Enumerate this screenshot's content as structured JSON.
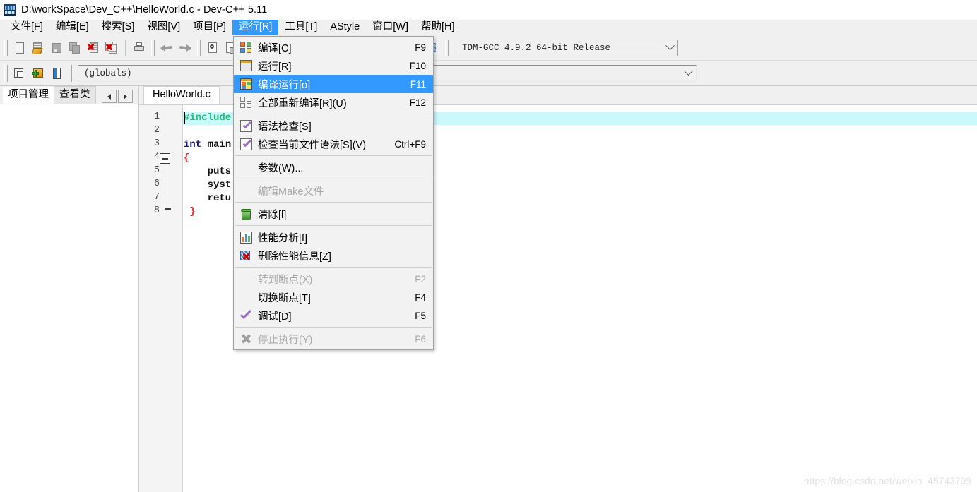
{
  "window": {
    "title": "D:\\workSpace\\Dev_C++\\HelloWorld.c - Dev-C++ 5.11",
    "icon": "devcpp-app-icon"
  },
  "menubar": {
    "items": [
      {
        "label": "文件[F]",
        "active": false
      },
      {
        "label": "编辑[E]",
        "active": false
      },
      {
        "label": "搜索[S]",
        "active": false
      },
      {
        "label": "视图[V]",
        "active": false
      },
      {
        "label": "项目[P]",
        "active": false
      },
      {
        "label": "运行[R]",
        "active": true
      },
      {
        "label": "工具[T]",
        "active": false
      },
      {
        "label": "AStyle",
        "active": false
      },
      {
        "label": "窗口[W]",
        "active": false
      },
      {
        "label": "帮助[H]",
        "active": false
      }
    ]
  },
  "toolbar": {
    "row1": [
      {
        "icon": "new-file-icon"
      },
      {
        "icon": "open-file-icon"
      },
      {
        "icon": "save-file-icon"
      },
      {
        "icon": "save-all-icon"
      },
      {
        "icon": "close-file-icon"
      },
      {
        "icon": "close-all-icon"
      },
      {
        "icon": "print-icon"
      },
      {
        "icon": "undo-icon"
      },
      {
        "icon": "redo-icon"
      },
      {
        "icon": "find-icon"
      },
      {
        "icon": "replace-icon"
      },
      {
        "icon": "goto-line-icon"
      },
      {
        "icon": "compile-icon"
      },
      {
        "icon": "run-icon"
      },
      {
        "icon": "compile-run-icon"
      },
      {
        "icon": "rebuild-all-icon"
      },
      {
        "icon": "debug-check-icon"
      },
      {
        "icon": "stop-execution-icon"
      },
      {
        "icon": "profile-analysis-icon"
      },
      {
        "icon": "delete-profile-icon"
      }
    ],
    "compiler_combo": {
      "value": "TDM-GCC 4.9.2 64-bit Release",
      "arrow": "chevron-down-icon"
    },
    "row2": [
      {
        "icon": "new-project-window-icon"
      },
      {
        "icon": "add-to-project-icon"
      },
      {
        "icon": "project-book-icon"
      }
    ],
    "scope_combo": {
      "value": "(globals)",
      "arrow": "chevron-down-icon"
    }
  },
  "left_panel": {
    "tabs": [
      {
        "label": "项目管理",
        "selected": true
      },
      {
        "label": "查看类",
        "selected": false
      }
    ],
    "nav": [
      {
        "icon": "arrow-left-icon"
      },
      {
        "icon": "arrow-right-icon"
      }
    ]
  },
  "editor": {
    "tabs": [
      {
        "label": "HelloWorld.c",
        "selected": true
      }
    ],
    "line_numbers": [
      "1",
      "2",
      "3",
      "4",
      "5",
      "6",
      "7",
      "8"
    ],
    "current_line": 1,
    "fold_start_line": 4,
    "fold_end_line": 8,
    "lines": [
      {
        "n": 1,
        "tokens": [
          {
            "t": "#include",
            "c": "c-pre"
          }
        ]
      },
      {
        "n": 2,
        "tokens": []
      },
      {
        "n": 3,
        "tokens": [
          {
            "t": "int ",
            "c": "c-kw"
          },
          {
            "t": "main",
            "c": "c-id"
          }
        ]
      },
      {
        "n": 4,
        "tokens": [
          {
            "t": "{",
            "c": "c-brace"
          }
        ]
      },
      {
        "n": 5,
        "tokens": [
          {
            "t": "    puts",
            "c": "c-id"
          }
        ]
      },
      {
        "n": 6,
        "tokens": [
          {
            "t": "    syst",
            "c": "c-id"
          }
        ]
      },
      {
        "n": 7,
        "tokens": [
          {
            "t": "    retu",
            "c": "c-id"
          }
        ]
      },
      {
        "n": 8,
        "tokens": [
          {
            "t": " }",
            "c": "c-brace"
          }
        ]
      }
    ]
  },
  "run_menu": {
    "items": [
      {
        "label": "编译[C]",
        "shortcut": "F9",
        "icon": "compile-icon",
        "state": "normal"
      },
      {
        "label": "运行[R]",
        "shortcut": "F10",
        "icon": "run-window-icon",
        "state": "normal"
      },
      {
        "label": "编译运行[o]",
        "shortcut": "F11",
        "icon": "compile-run-icon",
        "state": "selected"
      },
      {
        "label": "全部重新编译[R](U)",
        "shortcut": "F12",
        "icon": "rebuild-all-icon",
        "state": "normal"
      },
      {
        "type": "separator"
      },
      {
        "label": "语法检查[S]",
        "shortcut": "",
        "icon": "syntax-check-icon",
        "state": "normal"
      },
      {
        "label": "检查当前文件语法[S](V)",
        "shortcut": "Ctrl+F9",
        "icon": "syntax-check-icon",
        "state": "normal"
      },
      {
        "type": "separator"
      },
      {
        "label": "参数(W)...",
        "shortcut": "",
        "icon": "none",
        "state": "normal"
      },
      {
        "type": "separator"
      },
      {
        "label": "编辑Make文件",
        "shortcut": "",
        "icon": "none",
        "state": "disabled"
      },
      {
        "type": "separator"
      },
      {
        "label": "清除[l]",
        "shortcut": "",
        "icon": "trash-icon",
        "state": "normal"
      },
      {
        "type": "separator"
      },
      {
        "label": "性能分析[f]",
        "shortcut": "",
        "icon": "profile-chart-icon",
        "state": "normal"
      },
      {
        "label": "删除性能信息[Z]",
        "shortcut": "",
        "icon": "delete-profile-icon",
        "state": "normal"
      },
      {
        "type": "separator"
      },
      {
        "label": "转到断点(X)",
        "shortcut": "F2",
        "icon": "none",
        "state": "disabled"
      },
      {
        "label": "切换断点[T]",
        "shortcut": "F4",
        "icon": "none",
        "state": "normal"
      },
      {
        "label": "调试[D]",
        "shortcut": "F5",
        "icon": "debug-check-icon",
        "state": "normal"
      },
      {
        "type": "separator"
      },
      {
        "label": "停止执行(Y)",
        "shortcut": "F6",
        "icon": "stop-execution-icon",
        "state": "disabled"
      }
    ]
  },
  "watermark": {
    "text": "https://blog.csdn.net/weixin_45743799"
  },
  "colors": {
    "accent": "#3399ff",
    "chrome": "#f0f0f0",
    "current_line": "#caf8fb",
    "preprocessor": "#1fbf7a",
    "keyword": "#1a1a8c",
    "brace": "#e03030"
  }
}
